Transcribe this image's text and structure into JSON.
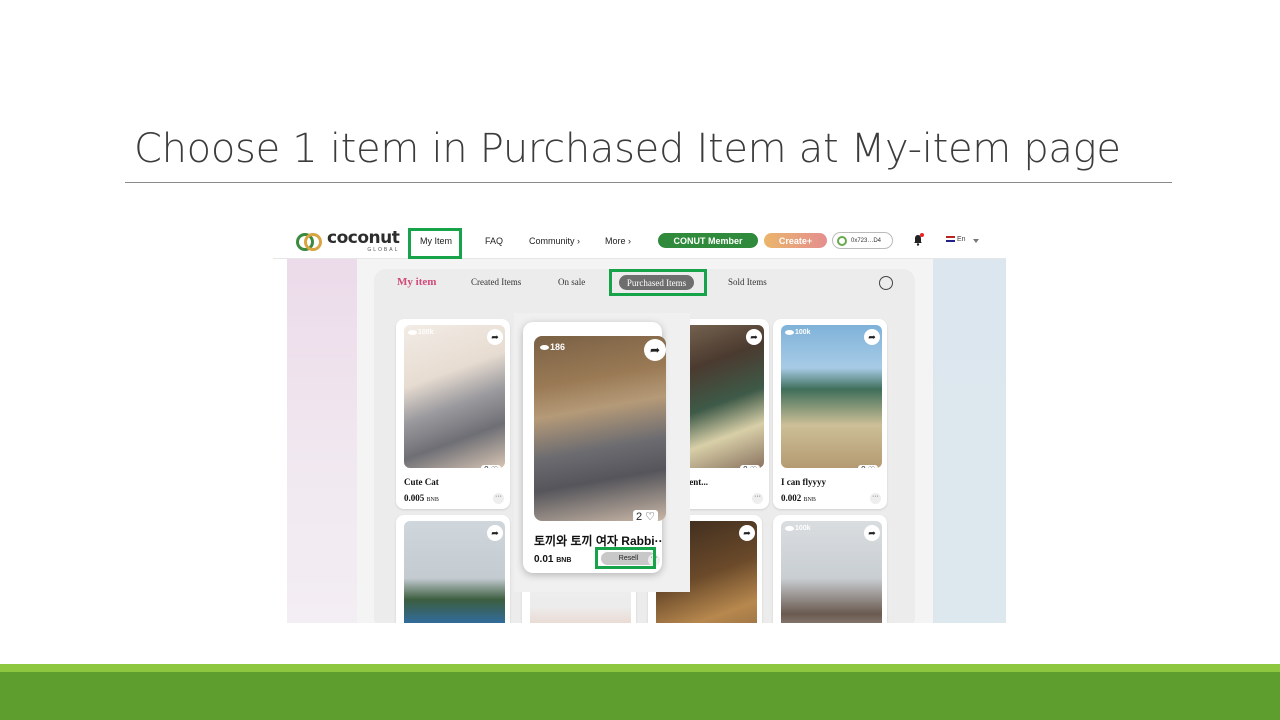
{
  "slide": {
    "title": "Choose 1 item in Purchased Item at My-item page"
  },
  "nav": {
    "logo_word": "coconut",
    "logo_sub": "GLOBAL",
    "my_item": "My Item",
    "faq": "FAQ",
    "community": "Community ›",
    "more": "More ›",
    "member_button": "CONUT Member",
    "create_button": "Create+",
    "wallet": "0x723…D4",
    "language": "En"
  },
  "tabs": {
    "my_item": "My item",
    "created": "Created Items",
    "on_sale": "On sale",
    "purchased": "Purchased Items",
    "sold": "Sold Items"
  },
  "cards": [
    {
      "views": "100k",
      "likes": "0 ♡",
      "name": "Cute Cat",
      "price": "0.005",
      "currency": "BNB"
    },
    {
      "views": "",
      "likes": "0 ♡",
      "name": "y moment...",
      "price": "",
      "currency": "NB"
    },
    {
      "views": "100k",
      "likes": "0 ♡",
      "name": "I can flyyyy",
      "price": "0.002",
      "currency": "BNB"
    },
    {
      "views": "100k"
    }
  ],
  "popout": {
    "views": "186",
    "likes": "2 ♡",
    "name": "토끼와 토끼 여자 Rabbi···",
    "price": "0.01",
    "currency": "BNB",
    "resell_button": "Resell"
  },
  "icons": {
    "share": "share-arrow-icon",
    "eye": "eye-icon",
    "heart": "heart-icon",
    "more": "ellipsis-icon",
    "bell": "bell-icon",
    "filter": "filter-icon"
  },
  "colors": {
    "highlight": "#17a34a",
    "brand_green": "#2f8a3b",
    "active_tab": "#d14a79",
    "footer_green": "#5e9e2f",
    "footer_lime": "#8dc63f"
  }
}
